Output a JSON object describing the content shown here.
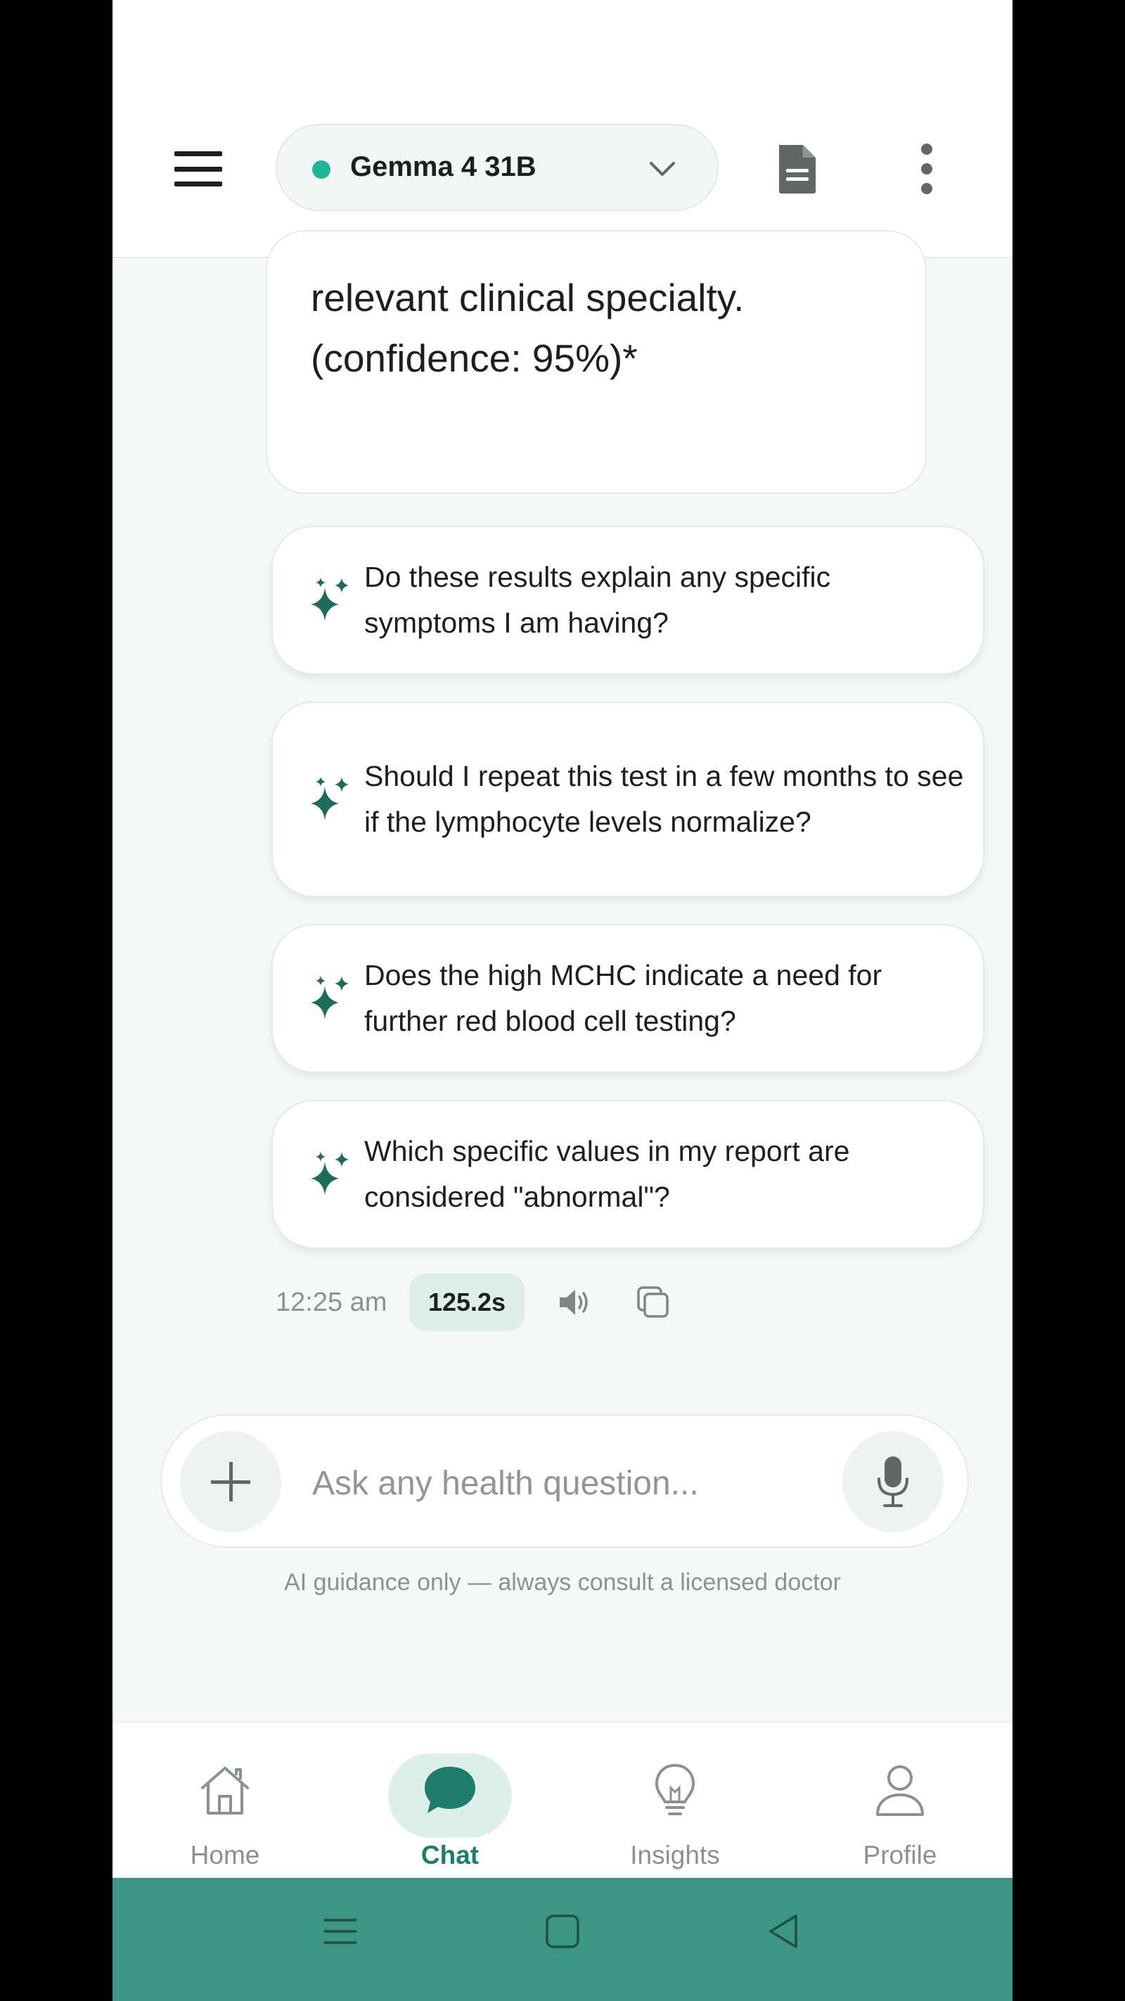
{
  "header": {
    "model_name": "Gemma 4 31B",
    "status_color": "#1fb596",
    "icons": [
      "menu-icon",
      "chevron-down-icon",
      "document-icon",
      "more-vertical-icon"
    ]
  },
  "message": {
    "lines": [
      "relevant clinical specialty.",
      "(confidence: 95%)*"
    ]
  },
  "suggestions": [
    {
      "text": "Do these results explain any specific symptoms I am having?"
    },
    {
      "text": "Should I repeat this test in a few months to see if the lymphocyte levels normalize?"
    },
    {
      "text": "Does the high MCHC indicate a need for further red blood cell testing?"
    },
    {
      "text": "Which specific values in my report are considered \"abnormal\"?"
    }
  ],
  "meta": {
    "time": "12:25 am",
    "duration": "125.2s"
  },
  "composer": {
    "placeholder": "Ask any health question..."
  },
  "disclaimer": "AI guidance only — always consult a licensed doctor",
  "nav": {
    "items": [
      {
        "label": "Home",
        "icon": "home-icon"
      },
      {
        "label": "Chat",
        "icon": "chat-icon",
        "active": true
      },
      {
        "label": "Insights",
        "icon": "lightbulb-icon"
      },
      {
        "label": "Profile",
        "icon": "person-icon"
      }
    ]
  },
  "colors": {
    "accent": "#1e7d6a",
    "sparkle": "#1e6b5c",
    "system_nav": "#3d9684"
  }
}
